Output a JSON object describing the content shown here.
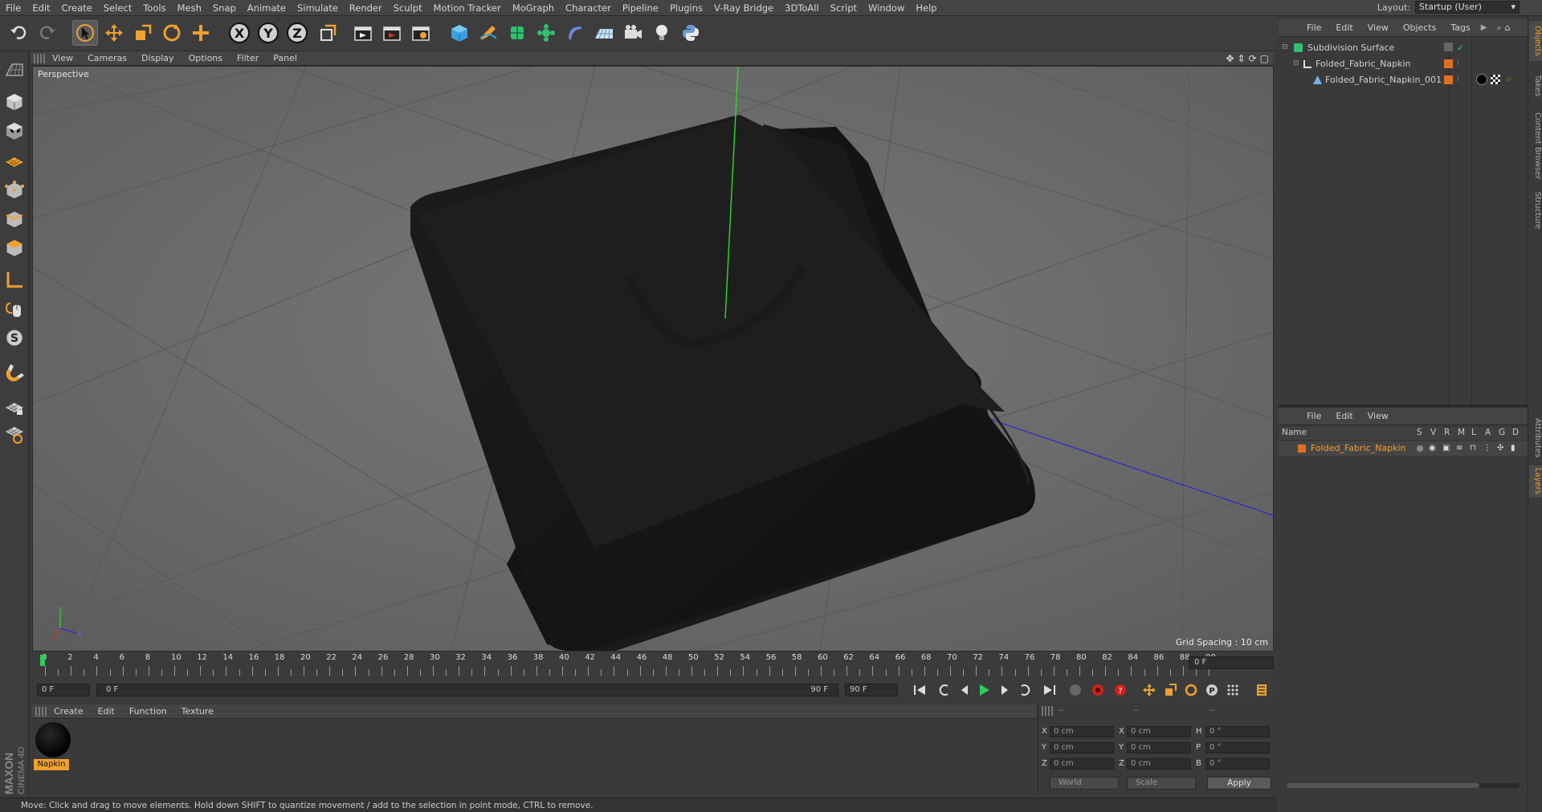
{
  "menubar": {
    "items": [
      "File",
      "Edit",
      "Create",
      "Select",
      "Tools",
      "Mesh",
      "Snap",
      "Animate",
      "Simulate",
      "Render",
      "Sculpt",
      "Motion Tracker",
      "MoGraph",
      "Character",
      "Pipeline",
      "Plugins",
      "V-Ray Bridge",
      "3DToAll",
      "Script",
      "Window",
      "Help"
    ],
    "layout_label": "Layout:",
    "layout_value": "Startup (User)"
  },
  "toolbar": {
    "axis_x": "X",
    "axis_y": "Y",
    "axis_z": "Z",
    "icons": [
      "undo-icon",
      "redo-icon",
      "select-arrow-icon",
      "move-icon",
      "scale-icon",
      "rotate-icon",
      "add-icon",
      "x-axis-icon",
      "y-axis-icon",
      "z-axis-icon",
      "coordinate-system-icon",
      "render-view-icon",
      "render-picture-viewer-icon",
      "render-settings-icon",
      "cube-icon",
      "pen-icon",
      "subdivision-icon",
      "cloner-icon",
      "deformer-icon",
      "floor-icon",
      "camera-icon",
      "light-icon",
      "python-icon"
    ]
  },
  "viewport": {
    "menu": [
      "View",
      "Cameras",
      "Display",
      "Options",
      "Filter",
      "Panel"
    ],
    "label": "Perspective",
    "grid_spacing": "Grid Spacing : 10 cm",
    "accent_green": "#2bdc2b",
    "accent_blue": "#2b2bc8"
  },
  "timeline": {
    "ticks": [
      "0",
      "2",
      "4",
      "6",
      "8",
      "10",
      "12",
      "14",
      "16",
      "18",
      "20",
      "22",
      "24",
      "26",
      "28",
      "30",
      "32",
      "34",
      "36",
      "38",
      "40",
      "42",
      "44",
      "46",
      "48",
      "50",
      "52",
      "54",
      "56",
      "58",
      "60",
      "62",
      "64",
      "66",
      "68",
      "70",
      "72",
      "74",
      "76",
      "78",
      "80",
      "82",
      "84",
      "86",
      "88",
      "90"
    ],
    "current_frame_right": "0 F",
    "start_field": "0 F",
    "range_start": "0 F",
    "range_end": "90 F",
    "end_field": "90 F"
  },
  "material_manager": {
    "menu": [
      "Create",
      "Edit",
      "Function",
      "Texture"
    ],
    "materials": [
      {
        "name": "Napkin",
        "color": "#000000"
      }
    ]
  },
  "coordinates": {
    "header": [
      "--",
      "--",
      "--"
    ],
    "rows": [
      {
        "l1": "X",
        "v1": "0 cm",
        "l2": "X",
        "v2": "0 cm",
        "l3": "H",
        "v3": "0 °"
      },
      {
        "l1": "Y",
        "v1": "0 cm",
        "l2": "Y",
        "v2": "0 cm",
        "l3": "P",
        "v3": "0 °"
      },
      {
        "l1": "Z",
        "v1": "0 cm",
        "l2": "Z",
        "v2": "0 cm",
        "l3": "B",
        "v3": "0 °"
      }
    ],
    "mode_world": "World",
    "mode_scale": "Scale",
    "apply_label": "Apply"
  },
  "objects_panel": {
    "menu": [
      "File",
      "Edit",
      "View",
      "Objects",
      "Tags"
    ],
    "items": [
      {
        "name": "Subdivision Surface"
      },
      {
        "name": "Folded_Fabric_Napkin"
      },
      {
        "name": "Folded_Fabric_Napkin_001"
      }
    ]
  },
  "layers_panel": {
    "menu": [
      "File",
      "Edit",
      "View"
    ],
    "columns": [
      "Name",
      "S",
      "V",
      "R",
      "M",
      "L",
      "A",
      "G",
      "D"
    ],
    "layer_name": "Folded_Fabric_Napkin",
    "layer_color": "#e07020"
  },
  "side_tabs": [
    "Objects",
    "Takes",
    "Content Browser",
    "Structure",
    "Attributes",
    "Layers"
  ],
  "status": {
    "text": "Move: Click and drag to move elements. Hold down SHIFT to quantize movement / add to the selection in point mode, CTRL to remove."
  },
  "logo": {
    "brand": "MAXON",
    "product": "CINEMA 4D"
  }
}
